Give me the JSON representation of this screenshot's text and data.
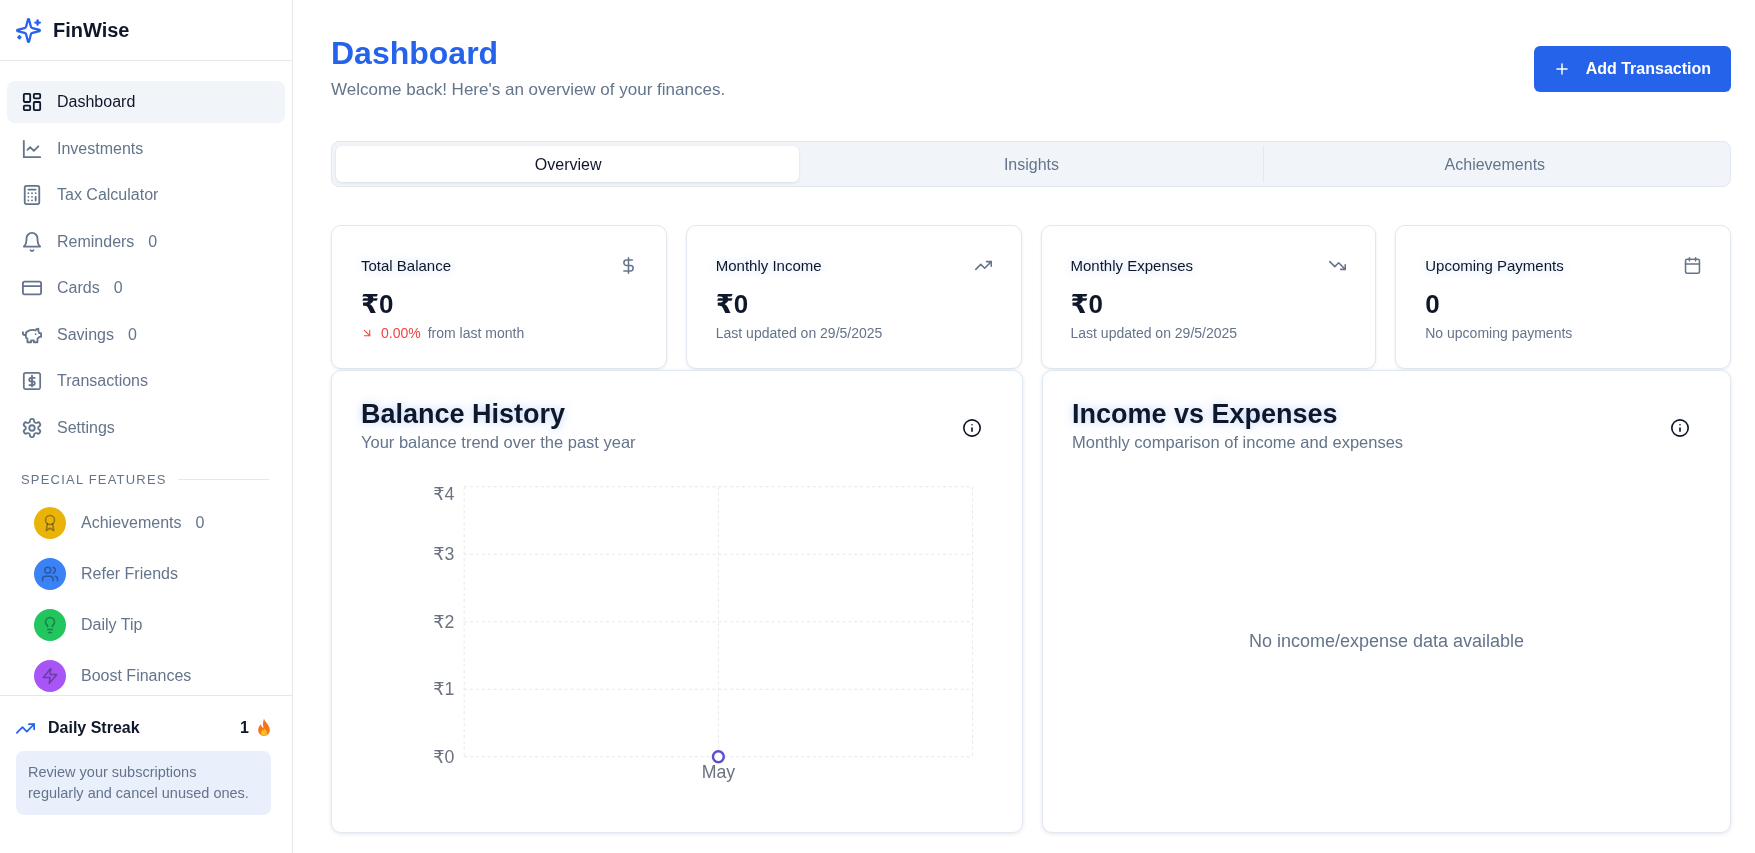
{
  "sidebar": {
    "brand": "FinWise",
    "nav_items": [
      {
        "label": "Dashboard",
        "selected": true
      },
      {
        "label": "Investments",
        "selected": false
      },
      {
        "label": "Tax Calculator",
        "selected": false
      },
      {
        "label": "Reminders",
        "selected": false,
        "count": "0"
      },
      {
        "label": "Cards",
        "selected": false,
        "count": "0"
      },
      {
        "label": "Savings",
        "selected": false,
        "count": "0"
      },
      {
        "label": "Transactions",
        "selected": false
      },
      {
        "label": "Settings",
        "selected": false
      }
    ],
    "section_title": "SPECIAL FEATURES",
    "special_items": [
      {
        "label": "Achievements",
        "color": "#eab308",
        "count": "0"
      },
      {
        "label": "Refer Friends",
        "color": "#3b82f6"
      },
      {
        "label": "Daily Tip",
        "color": "#22c55e"
      },
      {
        "label": "Boost Finances",
        "color": "#a855f7"
      }
    ],
    "streak": {
      "label": "Daily Streak",
      "count": "1"
    },
    "tip": "Review your subscriptions regularly and cancel unused ones."
  },
  "header": {
    "title": "Dashboard",
    "subtitle": "Welcome back! Here's an overview of your finances.",
    "button": "Add Transaction"
  },
  "tabs": [
    {
      "label": "Overview",
      "selected": true
    },
    {
      "label": "Insights",
      "selected": false
    },
    {
      "label": "Achievements",
      "selected": false
    }
  ],
  "stat_cards": [
    {
      "kind": "change",
      "title": "Total Balance",
      "value": "₹0",
      "change": "0.00%",
      "note": "from last month"
    },
    {
      "kind": "note",
      "title": "Monthly Income",
      "value": "₹0",
      "note": "Last updated on 29/5/2025"
    },
    {
      "kind": "note",
      "title": "Monthly Expenses",
      "value": "₹0",
      "note": "Last updated on 29/5/2025"
    },
    {
      "kind": "note",
      "title": "Upcoming Payments",
      "value": "0",
      "note": "No upcoming payments"
    }
  ],
  "charts": [
    {
      "kind": "chart",
      "title": "Balance History",
      "subtitle": "Your balance trend over the past year",
      "chart_data": {
        "type": "line",
        "categories": [
          "May"
        ],
        "values": [
          0
        ],
        "ylim": [
          0,
          4
        ],
        "yticks": [
          {
            "value": 0,
            "label": "₹0"
          },
          {
            "value": 1,
            "label": "₹1"
          },
          {
            "value": 2,
            "label": "₹2"
          },
          {
            "value": 3,
            "label": "₹3"
          },
          {
            "value": 4,
            "label": "₹4"
          }
        ],
        "grid": true,
        "marker": true
      }
    },
    {
      "kind": "empty",
      "title": "Income vs Expenses",
      "subtitle": "Monthly comparison of income and expenses",
      "empty_message": "No income/expense data available"
    }
  ]
}
